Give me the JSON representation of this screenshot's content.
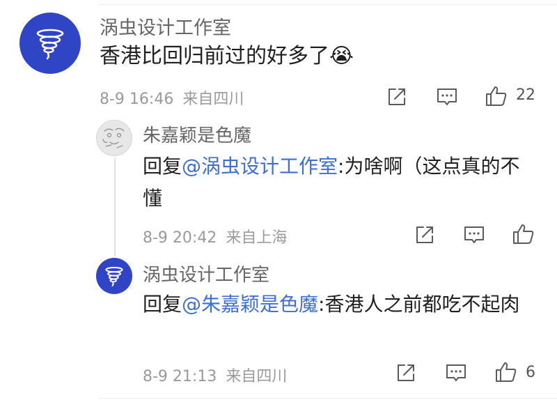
{
  "comment": {
    "author": "涡虫设计工作室",
    "text": "香港比回归前过的好多了",
    "emoji": "😭",
    "date": "8-9 16:46",
    "location": "来自四川",
    "like_count": "22"
  },
  "replies": [
    {
      "author": "朱嘉颖是色魔",
      "prefix": "回复",
      "mention": "@涡虫设计工作室",
      "text": ":为啥啊（这点真的不懂",
      "date": "8-9 20:42",
      "location": "来自上海",
      "like_count": ""
    },
    {
      "author": "涡虫设计工作室",
      "prefix": "回复",
      "mention": "@朱嘉颖是色魔",
      "text": ":香港人之前都吃不起肉",
      "date": "8-9 21:13",
      "location": "来自四川",
      "like_count": "6"
    }
  ],
  "colors": {
    "brand_blue": "#2f45c6",
    "mention": "#3b6fd6",
    "meta_gray": "#9a9a9a"
  },
  "icons": [
    "share-icon",
    "comment-icon",
    "like-icon",
    "tornado-logo-icon"
  ]
}
